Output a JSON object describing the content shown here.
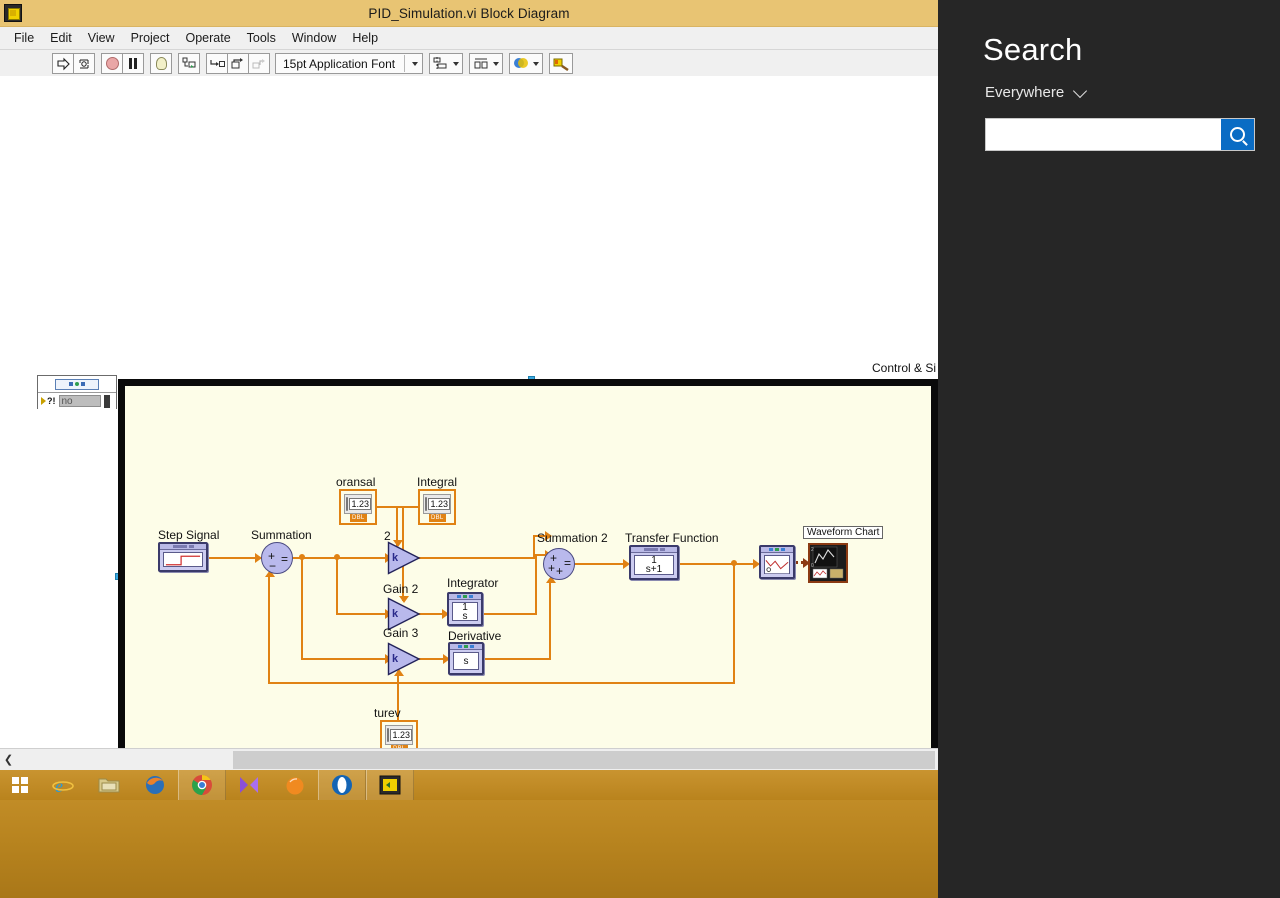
{
  "window": {
    "title": "PID_Simulation.vi Block Diagram",
    "icon": "labview-vi-icon"
  },
  "menubar": {
    "items": [
      {
        "label": "File"
      },
      {
        "label": "Edit"
      },
      {
        "label": "View"
      },
      {
        "label": "Project"
      },
      {
        "label": "Operate"
      },
      {
        "label": "Tools"
      },
      {
        "label": "Window"
      },
      {
        "label": "Help"
      }
    ]
  },
  "toolbar": {
    "run_label": "⇨",
    "run_continuous_label": "⟳",
    "abort_label": "",
    "pause_label": "",
    "highlight_label": "",
    "retain_label": "",
    "step_into_label": "↳□",
    "step_over_label": "→",
    "step_out_label": "",
    "font": "15pt Application Font",
    "align_label": "",
    "distribute_label": "",
    "reorder_label": "",
    "cleanup_label": ""
  },
  "diagram": {
    "loop_label": "Control & Si",
    "case_selector_value": "no",
    "nodes": [
      {
        "name": "step-signal",
        "label": "Step Signal"
      },
      {
        "name": "summation",
        "label": "Summation",
        "signs": [
          "+",
          "−",
          "="
        ]
      },
      {
        "name": "oransal-control",
        "label": "oransal",
        "value": "1.23",
        "type": "DBL"
      },
      {
        "name": "integral-control",
        "label": "Integral",
        "value": "1.23",
        "type": "DBL"
      },
      {
        "name": "turev-control",
        "label": "turev",
        "value": "1.23",
        "type": "DBL"
      },
      {
        "name": "gain-2",
        "label": "Gain 2",
        "top_label": "2",
        "k": "k"
      },
      {
        "name": "gain-3",
        "label": "Gain 3",
        "k": "k"
      },
      {
        "name": "gain-4",
        "label": "",
        "k": "k"
      },
      {
        "name": "integrator",
        "label": "Integrator",
        "numerator": "1",
        "denominator": "s"
      },
      {
        "name": "derivative",
        "label": "Derivative",
        "expr": "s"
      },
      {
        "name": "summation-2",
        "label": "Summation 2",
        "signs": [
          "+",
          "+",
          "+",
          "="
        ]
      },
      {
        "name": "transfer-function",
        "label": "Transfer Function",
        "numerator": "1",
        "denominator": "s+1"
      },
      {
        "name": "collector",
        "label": ""
      },
      {
        "name": "waveform-chart",
        "label": "Waveform Chart"
      }
    ]
  },
  "scrollbar": {
    "left_arrow": "❮"
  },
  "taskbar": {
    "start_label": "start-button",
    "items": [
      {
        "name": "internet-explorer-icon",
        "label": "e"
      },
      {
        "name": "file-explorer-icon",
        "label": ""
      },
      {
        "name": "firefox-icon",
        "label": ""
      },
      {
        "name": "chrome-icon",
        "label": ""
      },
      {
        "name": "media-player-icon",
        "label": ""
      },
      {
        "name": "orange-app-icon",
        "label": ""
      },
      {
        "name": "opera-icon",
        "label": ""
      },
      {
        "name": "labview-icon",
        "label": ""
      }
    ]
  },
  "search": {
    "title": "Search",
    "scope": "Everywhere",
    "query": "",
    "placeholder": "",
    "button_icon": "search-icon",
    "accent": "#0a6cc4"
  }
}
